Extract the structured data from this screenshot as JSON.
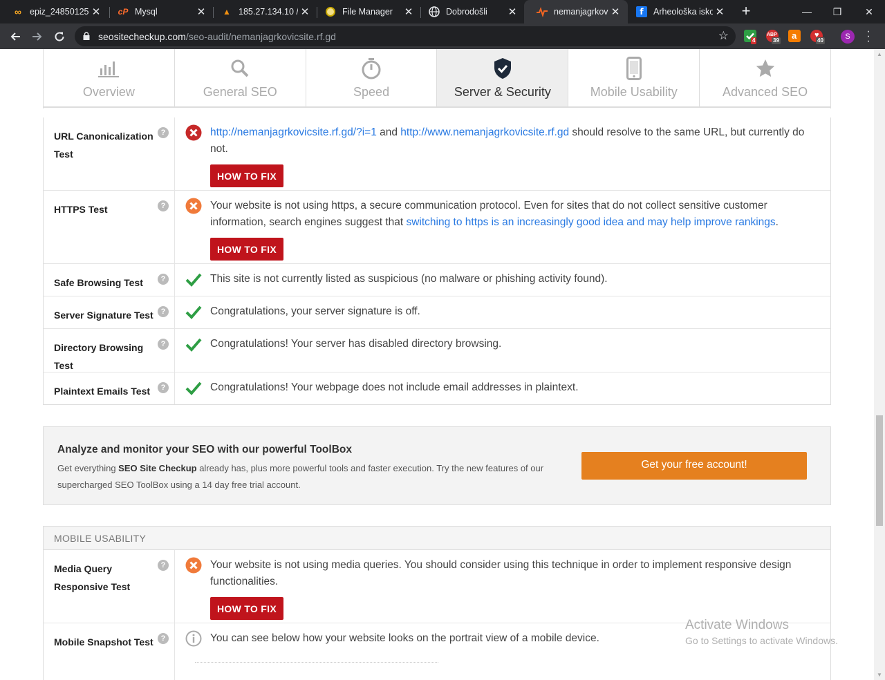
{
  "browser": {
    "tabs": [
      {
        "label": "epiz_24850125 (",
        "icon": "infinity-icon",
        "active": false
      },
      {
        "label": "Mysql",
        "icon": "cpanel-icon",
        "active": false
      },
      {
        "label": "185.27.134.10 / ",
        "icon": "phpmyadmin-icon",
        "active": false
      },
      {
        "label": "File Manager",
        "icon": "filemanager-icon",
        "active": false
      },
      {
        "label": "Dobrodošli",
        "icon": "globe-icon",
        "active": false
      },
      {
        "label": "nemanjagrkovic",
        "icon": "seo-pulse-icon",
        "active": true
      },
      {
        "label": "Arheološka isko",
        "icon": "facebook-icon",
        "active": false
      }
    ],
    "url_domain": "seositecheckup.com",
    "url_path": "/seo-audit/nemanjagrkovicsite.rf.gd",
    "extensions": [
      {
        "name": "shield-extension-icon",
        "badge": "4",
        "color": "#2e9e44"
      },
      {
        "name": "abp-extension-icon",
        "badge": "39",
        "color": "#d32f2f"
      },
      {
        "name": "shopping-extension-icon",
        "badge": "",
        "color": "#f57c00"
      },
      {
        "name": "notification-extension-icon",
        "badge": "40",
        "color": "#d32f2f"
      }
    ],
    "profile_initial": "S"
  },
  "section_nav": [
    {
      "label": "Overview",
      "icon": "bar-chart-icon",
      "active": false
    },
    {
      "label": "General SEO",
      "icon": "magnifier-icon",
      "active": false
    },
    {
      "label": "Speed",
      "icon": "stopwatch-icon",
      "active": false
    },
    {
      "label": "Server & Security",
      "icon": "shield-check-icon",
      "active": true
    },
    {
      "label": "Mobile Usability",
      "icon": "smartphone-icon",
      "active": false
    },
    {
      "label": "Advanced SEO",
      "icon": "star-icon",
      "active": false
    }
  ],
  "server_security": {
    "rows": [
      {
        "label": "URL Canonicalization Test",
        "status": "fail",
        "link1": "http://nemanjagrkovicsite.rf.gd/?i=1",
        "mid": " and ",
        "link2": "http://www.nemanjagrkovicsite.rf.gd",
        "tail": " should resolve to the same URL, but currently do not.",
        "fix": "HOW TO FIX"
      },
      {
        "label": "HTTPS Test",
        "status": "warn",
        "text": "Your website is not using https, a secure communication protocol. Even for sites that do not collect sensitive customer information, search engines suggest that ",
        "link": "switching to https is an increasingly good idea and may help improve rankings",
        "tail": ".",
        "fix": "HOW TO FIX"
      },
      {
        "label": "Safe Browsing Test",
        "status": "pass",
        "text": "This site is not currently listed as suspicious (no malware or phishing activity found)."
      },
      {
        "label": "Server Signature Test",
        "status": "pass",
        "text": "Congratulations, your server signature is off."
      },
      {
        "label": "Directory Browsing Test",
        "status": "pass",
        "text": "Congratulations! Your server has disabled directory browsing."
      },
      {
        "label": "Plaintext Emails Test",
        "status": "pass",
        "text": "Congratulations! Your webpage does not include email addresses in plaintext."
      }
    ]
  },
  "promo": {
    "title": "Analyze and monitor your SEO with our powerful ToolBox",
    "text_a": "Get everything ",
    "text_bold": "SEO Site Checkup",
    "text_b": " already has, plus more powerful tools and faster execution. Try the new features of our supercharged SEO ToolBox using a 14 day free trial account.",
    "button": "Get your free account!"
  },
  "mobile_usability": {
    "heading": "MOBILE USABILITY",
    "rows": [
      {
        "label": "Media Query Responsive Test",
        "status": "warn",
        "text": "Your website is not using media queries. You should consider using this technique in order to implement responsive design functionalities.",
        "fix": "HOW TO FIX"
      },
      {
        "label": "Mobile Snapshot Test",
        "status": "info",
        "text": "You can see below how your website looks on the portrait view of a mobile device."
      }
    ]
  },
  "watermark": {
    "line1": "Activate Windows",
    "line2": "Go to Settings to activate Windows."
  },
  "colors": {
    "fail": "#c62828",
    "warn": "#f07a3a",
    "pass": "#2e9e44",
    "fix_button": "#c0141c",
    "promo_button": "#e5801f",
    "link": "#2a7ae2"
  }
}
